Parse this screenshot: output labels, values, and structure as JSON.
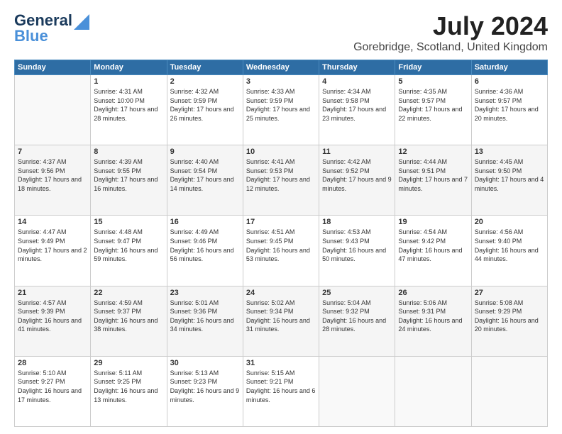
{
  "header": {
    "logo_line1": "General",
    "logo_line2": "Blue",
    "title": "July 2024",
    "subtitle": "Gorebridge, Scotland, United Kingdom"
  },
  "weekdays": [
    "Sunday",
    "Monday",
    "Tuesday",
    "Wednesday",
    "Thursday",
    "Friday",
    "Saturday"
  ],
  "weeks": [
    [
      {
        "day": "",
        "sunrise": "",
        "sunset": "",
        "daylight": ""
      },
      {
        "day": "1",
        "sunrise": "Sunrise: 4:31 AM",
        "sunset": "Sunset: 10:00 PM",
        "daylight": "Daylight: 17 hours and 28 minutes."
      },
      {
        "day": "2",
        "sunrise": "Sunrise: 4:32 AM",
        "sunset": "Sunset: 9:59 PM",
        "daylight": "Daylight: 17 hours and 26 minutes."
      },
      {
        "day": "3",
        "sunrise": "Sunrise: 4:33 AM",
        "sunset": "Sunset: 9:59 PM",
        "daylight": "Daylight: 17 hours and 25 minutes."
      },
      {
        "day": "4",
        "sunrise": "Sunrise: 4:34 AM",
        "sunset": "Sunset: 9:58 PM",
        "daylight": "Daylight: 17 hours and 23 minutes."
      },
      {
        "day": "5",
        "sunrise": "Sunrise: 4:35 AM",
        "sunset": "Sunset: 9:57 PM",
        "daylight": "Daylight: 17 hours and 22 minutes."
      },
      {
        "day": "6",
        "sunrise": "Sunrise: 4:36 AM",
        "sunset": "Sunset: 9:57 PM",
        "daylight": "Daylight: 17 hours and 20 minutes."
      }
    ],
    [
      {
        "day": "7",
        "sunrise": "Sunrise: 4:37 AM",
        "sunset": "Sunset: 9:56 PM",
        "daylight": "Daylight: 17 hours and 18 minutes."
      },
      {
        "day": "8",
        "sunrise": "Sunrise: 4:39 AM",
        "sunset": "Sunset: 9:55 PM",
        "daylight": "Daylight: 17 hours and 16 minutes."
      },
      {
        "day": "9",
        "sunrise": "Sunrise: 4:40 AM",
        "sunset": "Sunset: 9:54 PM",
        "daylight": "Daylight: 17 hours and 14 minutes."
      },
      {
        "day": "10",
        "sunrise": "Sunrise: 4:41 AM",
        "sunset": "Sunset: 9:53 PM",
        "daylight": "Daylight: 17 hours and 12 minutes."
      },
      {
        "day": "11",
        "sunrise": "Sunrise: 4:42 AM",
        "sunset": "Sunset: 9:52 PM",
        "daylight": "Daylight: 17 hours and 9 minutes."
      },
      {
        "day": "12",
        "sunrise": "Sunrise: 4:44 AM",
        "sunset": "Sunset: 9:51 PM",
        "daylight": "Daylight: 17 hours and 7 minutes."
      },
      {
        "day": "13",
        "sunrise": "Sunrise: 4:45 AM",
        "sunset": "Sunset: 9:50 PM",
        "daylight": "Daylight: 17 hours and 4 minutes."
      }
    ],
    [
      {
        "day": "14",
        "sunrise": "Sunrise: 4:47 AM",
        "sunset": "Sunset: 9:49 PM",
        "daylight": "Daylight: 17 hours and 2 minutes."
      },
      {
        "day": "15",
        "sunrise": "Sunrise: 4:48 AM",
        "sunset": "Sunset: 9:47 PM",
        "daylight": "Daylight: 16 hours and 59 minutes."
      },
      {
        "day": "16",
        "sunrise": "Sunrise: 4:49 AM",
        "sunset": "Sunset: 9:46 PM",
        "daylight": "Daylight: 16 hours and 56 minutes."
      },
      {
        "day": "17",
        "sunrise": "Sunrise: 4:51 AM",
        "sunset": "Sunset: 9:45 PM",
        "daylight": "Daylight: 16 hours and 53 minutes."
      },
      {
        "day": "18",
        "sunrise": "Sunrise: 4:53 AM",
        "sunset": "Sunset: 9:43 PM",
        "daylight": "Daylight: 16 hours and 50 minutes."
      },
      {
        "day": "19",
        "sunrise": "Sunrise: 4:54 AM",
        "sunset": "Sunset: 9:42 PM",
        "daylight": "Daylight: 16 hours and 47 minutes."
      },
      {
        "day": "20",
        "sunrise": "Sunrise: 4:56 AM",
        "sunset": "Sunset: 9:40 PM",
        "daylight": "Daylight: 16 hours and 44 minutes."
      }
    ],
    [
      {
        "day": "21",
        "sunrise": "Sunrise: 4:57 AM",
        "sunset": "Sunset: 9:39 PM",
        "daylight": "Daylight: 16 hours and 41 minutes."
      },
      {
        "day": "22",
        "sunrise": "Sunrise: 4:59 AM",
        "sunset": "Sunset: 9:37 PM",
        "daylight": "Daylight: 16 hours and 38 minutes."
      },
      {
        "day": "23",
        "sunrise": "Sunrise: 5:01 AM",
        "sunset": "Sunset: 9:36 PM",
        "daylight": "Daylight: 16 hours and 34 minutes."
      },
      {
        "day": "24",
        "sunrise": "Sunrise: 5:02 AM",
        "sunset": "Sunset: 9:34 PM",
        "daylight": "Daylight: 16 hours and 31 minutes."
      },
      {
        "day": "25",
        "sunrise": "Sunrise: 5:04 AM",
        "sunset": "Sunset: 9:32 PM",
        "daylight": "Daylight: 16 hours and 28 minutes."
      },
      {
        "day": "26",
        "sunrise": "Sunrise: 5:06 AM",
        "sunset": "Sunset: 9:31 PM",
        "daylight": "Daylight: 16 hours and 24 minutes."
      },
      {
        "day": "27",
        "sunrise": "Sunrise: 5:08 AM",
        "sunset": "Sunset: 9:29 PM",
        "daylight": "Daylight: 16 hours and 20 minutes."
      }
    ],
    [
      {
        "day": "28",
        "sunrise": "Sunrise: 5:10 AM",
        "sunset": "Sunset: 9:27 PM",
        "daylight": "Daylight: 16 hours and 17 minutes."
      },
      {
        "day": "29",
        "sunrise": "Sunrise: 5:11 AM",
        "sunset": "Sunset: 9:25 PM",
        "daylight": "Daylight: 16 hours and 13 minutes."
      },
      {
        "day": "30",
        "sunrise": "Sunrise: 5:13 AM",
        "sunset": "Sunset: 9:23 PM",
        "daylight": "Daylight: 16 hours and 9 minutes."
      },
      {
        "day": "31",
        "sunrise": "Sunrise: 5:15 AM",
        "sunset": "Sunset: 9:21 PM",
        "daylight": "Daylight: 16 hours and 6 minutes."
      },
      {
        "day": "",
        "sunrise": "",
        "sunset": "",
        "daylight": ""
      },
      {
        "day": "",
        "sunrise": "",
        "sunset": "",
        "daylight": ""
      },
      {
        "day": "",
        "sunrise": "",
        "sunset": "",
        "daylight": ""
      }
    ]
  ]
}
